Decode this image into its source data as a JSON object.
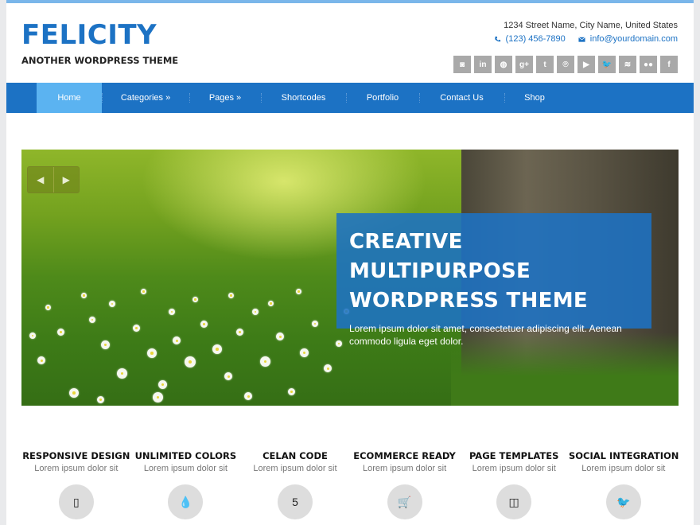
{
  "site": {
    "logo": "FELICITY",
    "tagline": "ANOTHER WORDPRESS THEME"
  },
  "contact": {
    "address": "1234 Street Name, City Name, United States",
    "phone": "(123) 456-7890",
    "email": "info@yourdomain.com"
  },
  "social": [
    {
      "icon": "instagram-icon",
      "glyph": "◙"
    },
    {
      "icon": "linkedin-icon",
      "glyph": "in"
    },
    {
      "icon": "dribbble-icon",
      "glyph": "◍"
    },
    {
      "icon": "google-plus-icon",
      "glyph": "g+"
    },
    {
      "icon": "tumblr-icon",
      "glyph": "t"
    },
    {
      "icon": "pinterest-icon",
      "glyph": "℗"
    },
    {
      "icon": "youtube-icon",
      "glyph": "▶"
    },
    {
      "icon": "twitter-icon",
      "glyph": "🐦"
    },
    {
      "icon": "rss-icon",
      "glyph": "≋"
    },
    {
      "icon": "flickr-icon",
      "glyph": "●●"
    },
    {
      "icon": "facebook-icon",
      "glyph": "f"
    }
  ],
  "nav": [
    {
      "label": "Home",
      "active": true
    },
    {
      "label": "Categories »",
      "active": false
    },
    {
      "label": "Pages »",
      "active": false
    },
    {
      "label": "Shortcodes",
      "active": false
    },
    {
      "label": "Portfolio",
      "active": false
    },
    {
      "label": "Contact Us",
      "active": false
    },
    {
      "label": "Shop",
      "active": false
    }
  ],
  "slider": {
    "title_line1": "CREATIVE MULTIPURPOSE",
    "title_line2": "WORDPRESS THEME",
    "text": "Lorem ipsum dolor sit amet, consectetuer adipiscing elit. Aenean commodo ligula eget dolor.",
    "prev_icon": "◀",
    "next_icon": "▶"
  },
  "features": [
    {
      "title": "RESPONSIVE DESIGN",
      "sub": "Lorem ipsum dolor sit",
      "icon": "mobile-icon",
      "glyph": "▯"
    },
    {
      "title": "UNLIMITED COLORS",
      "sub": "Lorem ipsum dolor sit",
      "icon": "droplet-icon",
      "glyph": "💧"
    },
    {
      "title": "CELAN CODE",
      "sub": "Lorem ipsum dolor sit",
      "icon": "html5-icon",
      "glyph": "5"
    },
    {
      "title": "ECOMMERCE READY",
      "sub": "Lorem ipsum dolor sit",
      "icon": "cart-icon",
      "glyph": "🛒"
    },
    {
      "title": "PAGE TEMPLATES",
      "sub": "Lorem ipsum dolor sit",
      "icon": "columns-icon",
      "glyph": "◫"
    },
    {
      "title": "SOCIAL INTEGRATION",
      "sub": "Lorem ipsum dolor sit",
      "icon": "twitter-icon",
      "glyph": "🐦"
    }
  ],
  "colors": {
    "brand": "#1c72c4",
    "nav_active": "#5bb3f1",
    "social_bg": "#a9a9a9"
  }
}
